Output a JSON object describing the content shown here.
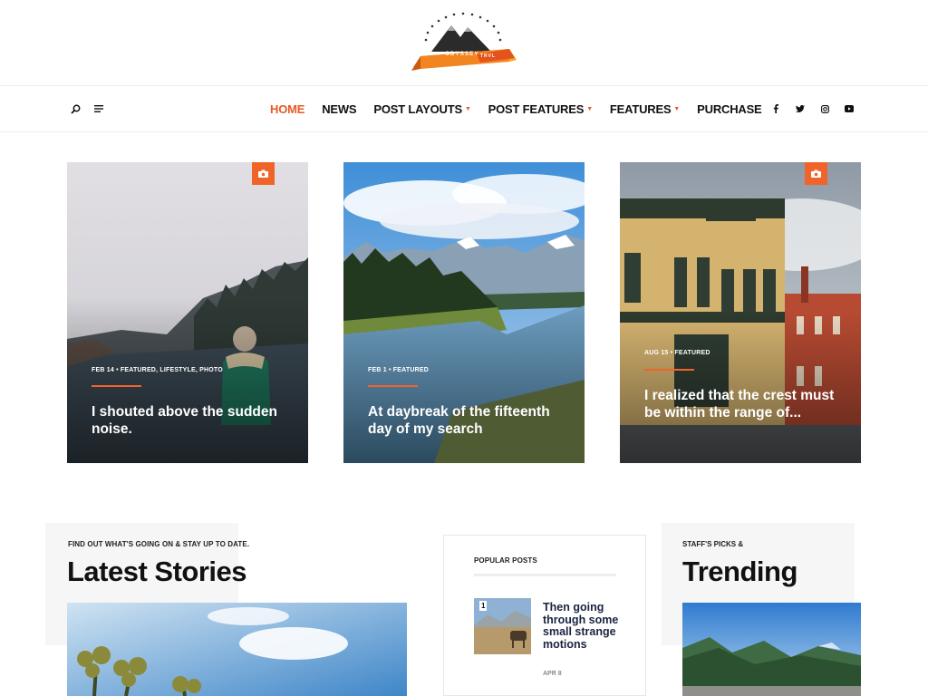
{
  "brand": {
    "logo_text": "ODYSSEY",
    "logo_text2": "TRVL"
  },
  "nav": {
    "items": [
      {
        "label": "HOME",
        "active": true,
        "caret": false
      },
      {
        "label": "NEWS",
        "active": false,
        "caret": false
      },
      {
        "label": "POST LAYOUTS",
        "active": false,
        "caret": true
      },
      {
        "label": "POST FEATURES",
        "active": false,
        "caret": true
      },
      {
        "label": "FEATURES",
        "active": false,
        "caret": true
      },
      {
        "label": "PURCHASE",
        "active": false,
        "caret": false
      }
    ],
    "left_icons": [
      "search-icon",
      "menu-icon"
    ],
    "social": [
      "facebook-icon",
      "twitter-icon",
      "instagram-icon",
      "youtube-icon"
    ]
  },
  "featured": [
    {
      "meta": "FEB 14  •  FEATURED, LIFESTYLE, PHOTO",
      "title": "I shouted above the sudden noise.",
      "camera": true
    },
    {
      "meta": "FEB 1  •  FEATURED",
      "title": "At daybreak of the fifteenth day of my search",
      "camera": false
    },
    {
      "meta": "AUG 15  •  FEATURED",
      "title": "I realized that the crest must be within the range of...",
      "camera": true
    }
  ],
  "latest": {
    "kicker": "FIND OUT WHAT'S GOING ON & STAY UP TO DATE.",
    "title": "Latest Stories"
  },
  "popular": {
    "heading": "POPULAR POSTS",
    "items": [
      {
        "num": "1",
        "title": "Then going through some small strange motions",
        "date": "APR 8"
      }
    ]
  },
  "trending": {
    "kicker": "STAFF'S PICKS &",
    "title": "Trending"
  },
  "colors": {
    "accent": "#e85a23",
    "camera_bg": "#f0642a",
    "text": "#111111"
  }
}
